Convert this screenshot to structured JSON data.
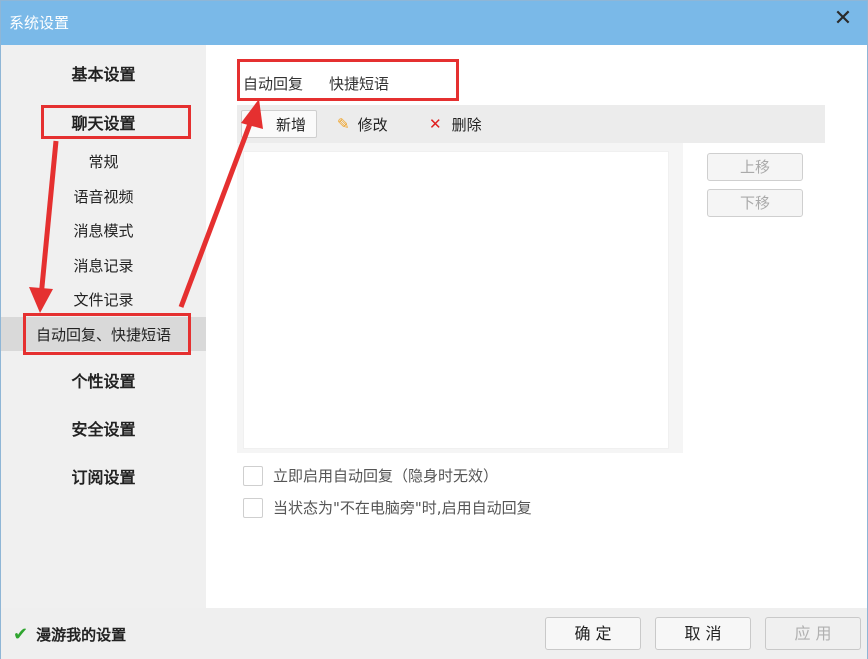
{
  "window": {
    "title": "系统设置"
  },
  "sidebar": {
    "categories": [
      "基本设置",
      "聊天设置",
      "个性设置",
      "安全设置",
      "订阅设置"
    ],
    "chat_items": [
      "常规",
      "语音视频",
      "消息模式",
      "消息记录",
      "文件记录",
      "自动回复、快捷短语"
    ]
  },
  "tabs": [
    "自动回复",
    "快捷短语"
  ],
  "toolbar": {
    "new": "新增",
    "edit": "修改",
    "delete": "删除"
  },
  "list_buttons": {
    "up": "上移",
    "down": "下移"
  },
  "options": [
    {
      "label": "立即启用自动回复（隐身时无效）",
      "checked": false
    },
    {
      "label": "当状态为\"不在电脑旁\"时,启用自动回复",
      "checked": false
    }
  ],
  "footer": {
    "roam_label": "漫游我的设置",
    "roam_checked": true,
    "ok": "确 定",
    "cancel": "取 消",
    "apply": "应 用"
  },
  "colors": {
    "titlebar": "#7ab9e8",
    "highlight": "#e53030",
    "check": "#2fa52f"
  }
}
